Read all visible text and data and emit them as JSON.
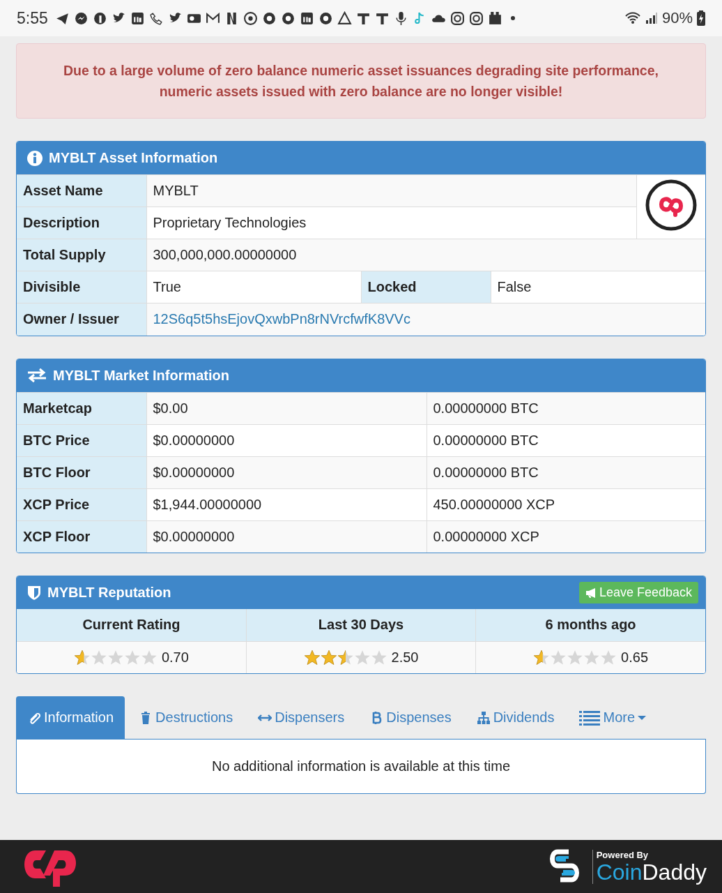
{
  "status_bar": {
    "time": "5:55",
    "battery": "90%"
  },
  "alert": {
    "text": "Due to a large volume of zero balance numeric asset issuances degrading site performance,\nnumeric assets issued with zero balance are no longer visible!"
  },
  "asset_panel": {
    "title": "MYBLT Asset Information",
    "asset_name": {
      "label": "Asset Name",
      "value": "MYBLT"
    },
    "description": {
      "label": "Description",
      "value": "Proprietary Technologies"
    },
    "total_supply": {
      "label": "Total Supply",
      "value": "300,000,000.00000000"
    },
    "divisible": {
      "label": "Divisible",
      "value": "True"
    },
    "locked": {
      "label": "Locked",
      "value": "False"
    },
    "owner": {
      "label": "Owner / Issuer",
      "value": "12S6q5t5hsEjovQxwbPn8rNVrcfwfK8VVc"
    }
  },
  "market_panel": {
    "title": "MYBLT Market Information",
    "rows": [
      {
        "label": "Marketcap",
        "usd": "$0.00",
        "native": "0.00000000 BTC"
      },
      {
        "label": "BTC Price",
        "usd": "$0.00000000",
        "native": "0.00000000 BTC"
      },
      {
        "label": "BTC Floor",
        "usd": "$0.00000000",
        "native": "0.00000000 BTC"
      },
      {
        "label": "XCP Price",
        "usd": "$1,944.00000000",
        "native": "450.00000000 XCP"
      },
      {
        "label": "XCP Floor",
        "usd": "$0.00000000",
        "native": "0.00000000 XCP"
      }
    ]
  },
  "reputation_panel": {
    "title": "MYBLT Reputation",
    "button": "Leave Feedback",
    "columns": [
      {
        "heading": "Current Rating",
        "stars": 0.7,
        "score": "0.70"
      },
      {
        "heading": "Last 30 Days",
        "stars": 2.5,
        "score": "2.50"
      },
      {
        "heading": "6 months ago",
        "stars": 0.65,
        "score": "0.65"
      }
    ]
  },
  "tabs": [
    {
      "label": "Information",
      "selected": true,
      "kind": "tab"
    },
    {
      "label": "Destructions",
      "selected": false,
      "kind": "tab"
    },
    {
      "label": "Dispensers",
      "selected": false,
      "kind": "tab"
    },
    {
      "label": "Dispenses",
      "selected": false,
      "kind": "tab"
    },
    {
      "label": "Dividends",
      "selected": false,
      "kind": "tab"
    },
    {
      "label": "More",
      "selected": false,
      "kind": "menu"
    }
  ],
  "tab_content": {
    "text": "No additional information is available at this time"
  },
  "footer": {
    "powered_by": "Powered By",
    "brand": [
      {
        "text": "Coin",
        "kind": "accent"
      },
      {
        "text": "Daddy",
        "kind": "plain"
      }
    ]
  }
}
